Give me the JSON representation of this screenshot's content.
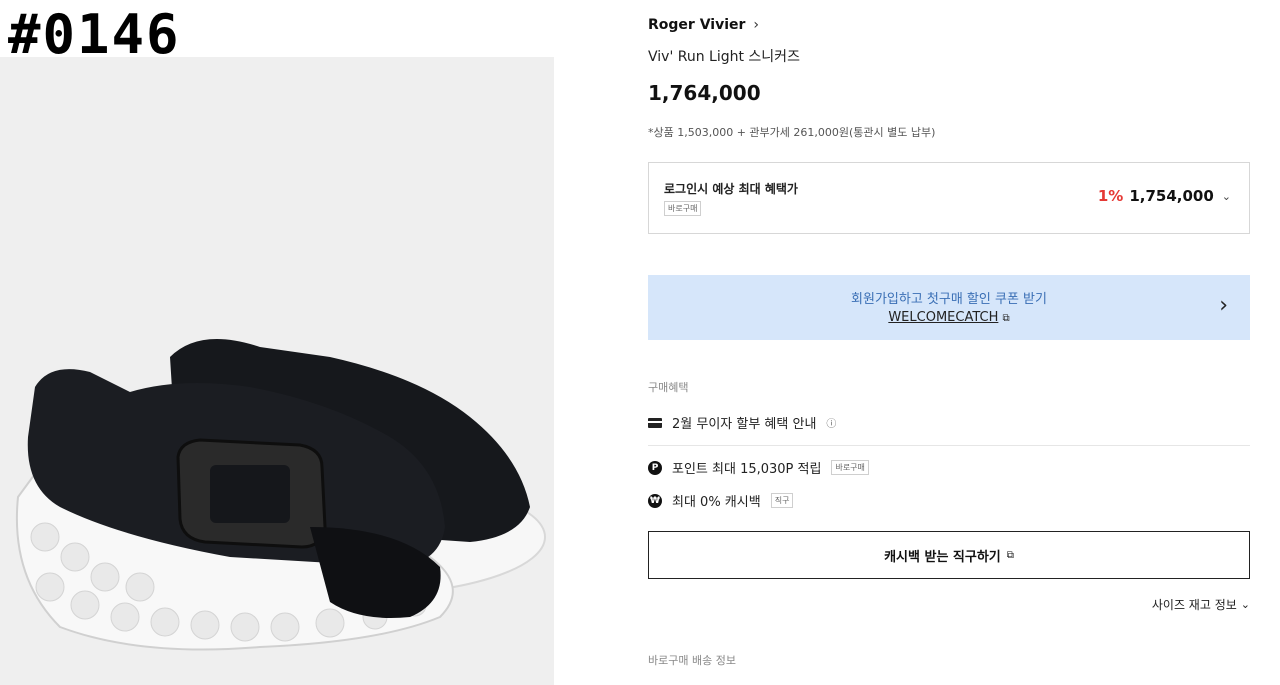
{
  "tag": "#0146",
  "brand": "Roger Vivier",
  "product_name": "Viv' Run Light 스니커즈",
  "price": "1,764,000",
  "price_note": "*상품 1,503,000 + 관부가세 261,000원(통관시 별도 납부)",
  "benefit_box": {
    "title": "로그인시 예상 최대 혜택가",
    "chip": "바로구매",
    "discount_percent": "1%",
    "discount_price": "1,754,000"
  },
  "coupon": {
    "headline": "회원가입하고 첫구매 할인 쿠폰 받기",
    "code": "WELCOMECATCH"
  },
  "purchase_benefits": {
    "label": "구매혜택",
    "installment": "2월 무이자 할부 혜택 안내",
    "points": "포인트 최대 15,030P 적립",
    "points_chip": "바로구매",
    "cashback": "최대 0% 캐시백",
    "cashback_chip": "직구"
  },
  "cashback_button": "캐시백 받는 직구하기",
  "size_stock": "사이즈 재고 정보",
  "shipping_label": "바로구매 배송 정보",
  "colors": {
    "discount_red": "#e53935",
    "coupon_bg": "#d6e6fa",
    "coupon_text": "#3a6fb5"
  }
}
